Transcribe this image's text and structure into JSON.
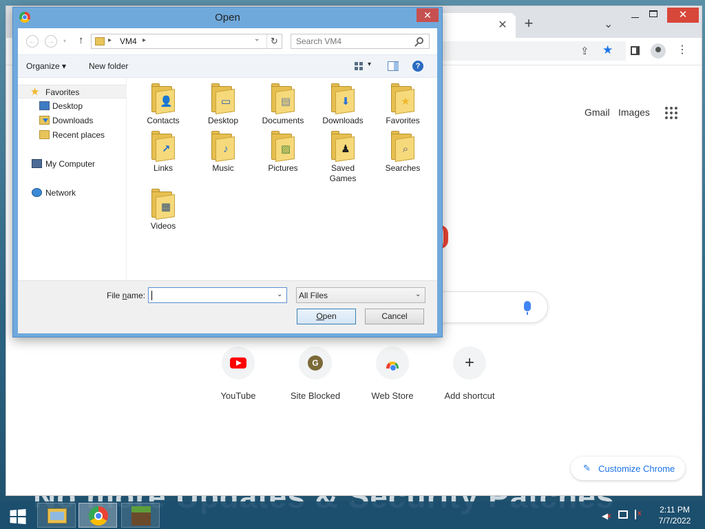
{
  "desktop": {
    "wallpaper_text": "No more Updates & Security Patches"
  },
  "chrome": {
    "tab_close": "✕",
    "tab_new": "+",
    "tab_search": "⌄",
    "window_close": "✕",
    "toolbar_menu": "⋮",
    "ntp": {
      "gmail_label": "Gmail",
      "images_label": "Images",
      "shortcuts": [
        {
          "label": "YouTube",
          "icon": "youtube-icon"
        },
        {
          "label": "Site Blocked",
          "icon": "g-letter-icon",
          "glyph": "G"
        },
        {
          "label": "Web Store",
          "icon": "web-store-icon"
        },
        {
          "label": "Add shortcut",
          "icon": "plus-icon",
          "glyph": "+"
        }
      ],
      "customize_label": "Customize Chrome",
      "customize_icon": "✎"
    },
    "colors": {
      "accent": "#1a73e8",
      "close_red": "#d7473a"
    }
  },
  "dialog": {
    "title": "Open",
    "close_glyph": "✕",
    "nav": {
      "back": "←",
      "forward": "→",
      "recent": "▾",
      "up": "↑"
    },
    "address": {
      "path": "VM4",
      "separator": "▸",
      "dropdown": "⌄",
      "refresh": "↻"
    },
    "search": {
      "placeholder": "Search VM4",
      "value": ""
    },
    "toolbar": {
      "organize_label": "Organize ▾",
      "new_folder_label": "New folder",
      "views_dropdown": "▾",
      "help_glyph": "?"
    },
    "navigation": [
      {
        "label": "Favorites",
        "icon": "star-icon",
        "selected": true
      },
      {
        "label": "Desktop",
        "icon": "desktop-icon"
      },
      {
        "label": "Downloads",
        "icon": "downloads-icon"
      },
      {
        "label": "Recent places",
        "icon": "recent-places-icon"
      },
      {
        "label": "My Computer",
        "icon": "computer-icon"
      },
      {
        "label": "Network",
        "icon": "network-icon"
      }
    ],
    "folders": [
      {
        "label": "Contacts",
        "icon": "contacts-folder-icon",
        "badge": "👤"
      },
      {
        "label": "Desktop",
        "icon": "desktop-folder-icon",
        "badge": "▭"
      },
      {
        "label": "Documents",
        "icon": "documents-folder-icon",
        "badge": "▤"
      },
      {
        "label": "Downloads",
        "icon": "downloads-folder-icon",
        "badge": "⬇"
      },
      {
        "label": "Favorites",
        "icon": "favorites-folder-icon",
        "badge": "★"
      },
      {
        "label": "Links",
        "icon": "links-folder-icon",
        "badge": "↗"
      },
      {
        "label": "Music",
        "icon": "music-folder-icon",
        "badge": "♪"
      },
      {
        "label": "Pictures",
        "icon": "pictures-folder-icon",
        "badge": "▨"
      },
      {
        "label": "Saved Games",
        "icon": "saved-games-folder-icon",
        "badge": "♟"
      },
      {
        "label": "Searches",
        "icon": "searches-folder-icon",
        "badge": "⌕"
      },
      {
        "label": "Videos",
        "icon": "videos-folder-icon",
        "badge": "▦"
      }
    ],
    "file_name": {
      "label_prefix": "File ",
      "label_accel": "n",
      "label_suffix": "ame:",
      "value": "",
      "dropdown": "⌄"
    },
    "file_type": {
      "value": "All Files",
      "dropdown": "⌄"
    },
    "buttons": {
      "open_accel": "O",
      "open_rest": "pen",
      "cancel_label": "Cancel"
    },
    "colors": {
      "frame": "#6fa9dc",
      "close": "#c75050"
    }
  },
  "taskbar": {
    "apps": [
      {
        "name": "file-explorer",
        "icon": "file-explorer-icon"
      },
      {
        "name": "chrome",
        "icon": "chrome-icon",
        "active": true
      },
      {
        "name": "minecraft",
        "icon": "minecraft-icon"
      }
    ],
    "tray": [
      "speaker-muted-icon",
      "network-icon",
      "action-center-flag-icon"
    ],
    "clock_time": "2:11 PM",
    "clock_date": "7/7/2022"
  }
}
